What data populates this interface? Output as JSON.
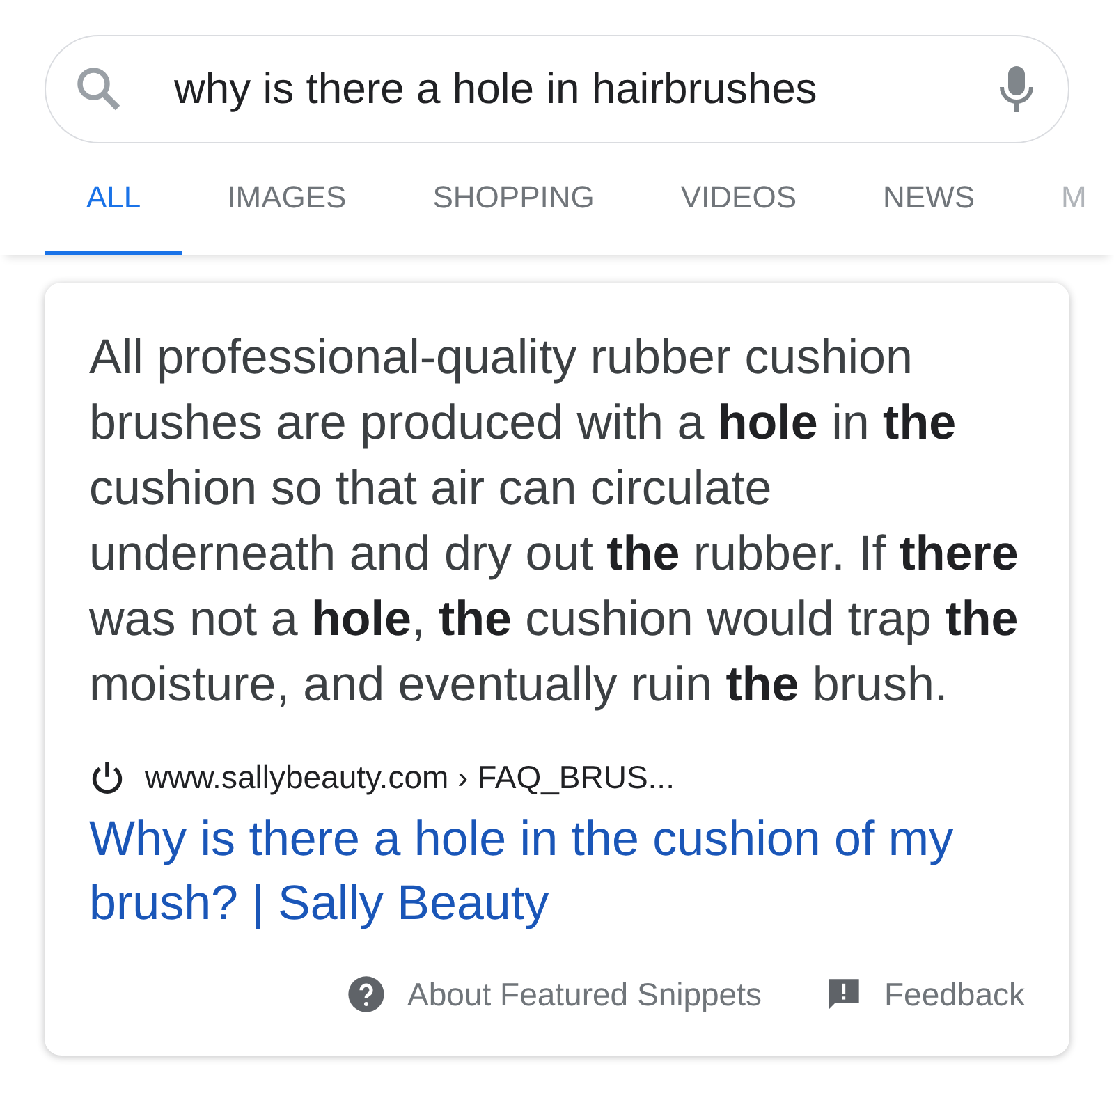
{
  "search": {
    "value": "why is there a hole in hairbrushes"
  },
  "tabs": [
    {
      "label": "ALL",
      "selected": true
    },
    {
      "label": "IMAGES",
      "selected": false
    },
    {
      "label": "SHOPPING",
      "selected": false
    },
    {
      "label": "VIDEOS",
      "selected": false
    },
    {
      "label": "NEWS",
      "selected": false
    },
    {
      "label": "M",
      "selected": false
    }
  ],
  "snippet": {
    "text": "All professional-quality rubber cushion brushes are produced with a **hole** in **the** cushion so that air can circulate underneath and dry out **the** rubber. If **there** was not a **hole**, **the** cushion would trap **the** moisture, and eventually ruin **the** brush.",
    "source": "www.sallybeauty.com › FAQ_BRUS...",
    "link": "Why is there a hole in the cushion of my brush? | Sally Beauty",
    "footer": [
      {
        "kind": "help",
        "label": "About Featured Snippets"
      },
      {
        "kind": "feedback",
        "label": "Feedback"
      }
    ]
  }
}
